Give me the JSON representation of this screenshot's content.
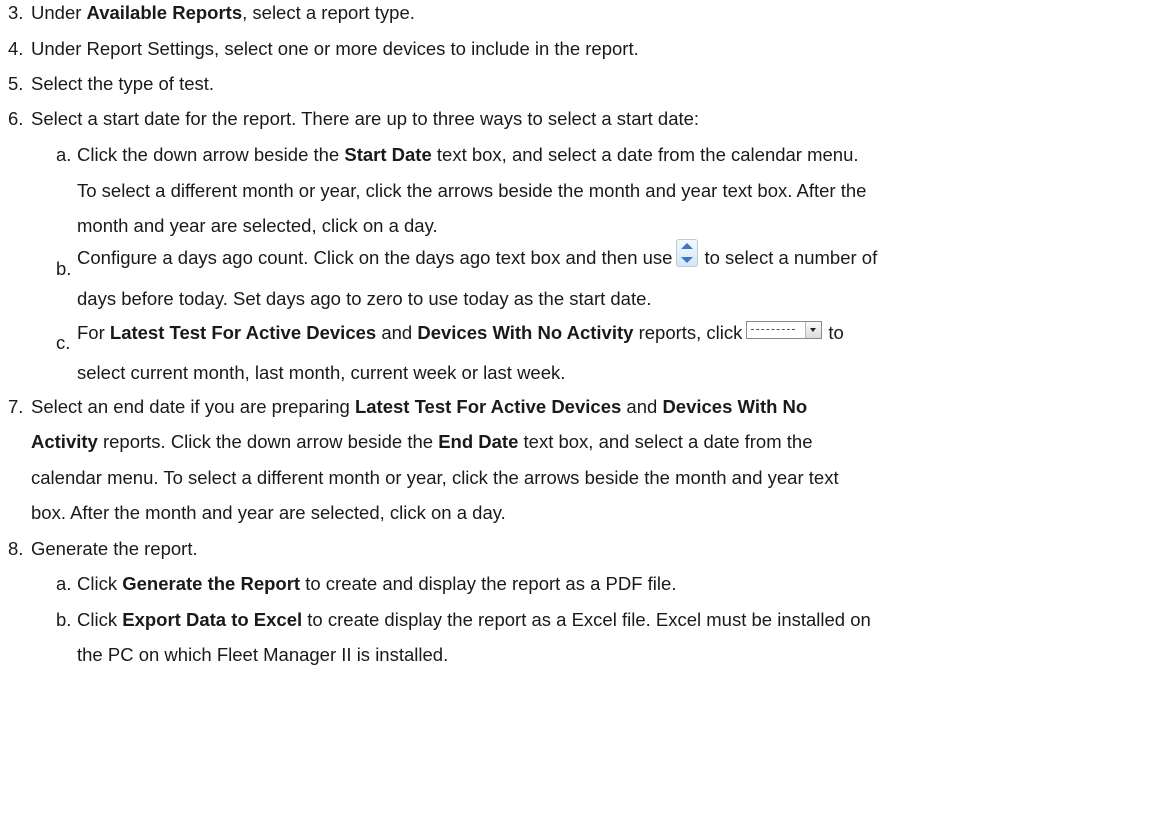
{
  "steps": [
    {
      "num": "3.",
      "pre": "Under ",
      "bold": "Available Reports",
      "post": ", select a report type."
    },
    {
      "num": "4.",
      "text": "Under Report Settings, select one or more devices to include in the report."
    },
    {
      "num": "5.",
      "text": "Select the type of test."
    },
    {
      "num": "6.",
      "text": "Select a start date for the report. There are up to three ways to select a start date:"
    },
    {
      "num": "7.",
      "line1_pre": "Select an end date if you are preparing ",
      "line1_b1": "Latest Test For Active Devices",
      "line1_mid": " and ",
      "line1_b2": "Devices With No",
      "line2_b": "Activity",
      "line2_pre": " reports. Click the down arrow beside the ",
      "line2_b2": "End Date",
      "line2_post": " text box, and select a date from the",
      "line3": "calendar menu. To select a different month or year, click the arrows beside the month and year text",
      "line4": "box. After the month and year are selected, click on a day."
    },
    {
      "num": "8.",
      "text": "Generate the report."
    }
  ],
  "step6_sub": {
    "a": {
      "letter": "a.",
      "l1_pre": "Click the down arrow beside the ",
      "l1_b": "Start Date",
      "l1_post": " text box, and select a date from the calendar menu.",
      "l2": "To select a different month or year, click the arrows beside the month and year text box. After the",
      "l3": "month and year are selected, click on a day."
    },
    "b": {
      "letter": "b.",
      "l1_pre": "Configure a days ago count. Click on the days ago text box and then use",
      "l1_post": "to select a number of",
      "l2": "days before today. Set days ago to zero to use today as the start date."
    },
    "c": {
      "letter": "c.",
      "l1_pre": "For ",
      "l1_b1": "Latest Test For Active Devices",
      "l1_mid": " and ",
      "l1_b2": "Devices With No Activity",
      "l1_post": " reports, click",
      "l1_end": "to",
      "l2": "select current month, last month, current week or last week."
    }
  },
  "step8_sub": {
    "a": {
      "letter": "a.",
      "pre": "Click ",
      "b": "Generate the Report",
      "post": " to create and display the report as a PDF file."
    },
    "b": {
      "letter": "b.",
      "pre": "Click ",
      "b": "Export Data to Excel",
      "post": " to create display the report as a Excel file. Excel must be installed on",
      "l2": "the PC on which Fleet Manager II is installed."
    }
  },
  "icons": {
    "spinner": "spin-arrows-icon",
    "dropdown": "dropdown-select-icon"
  }
}
